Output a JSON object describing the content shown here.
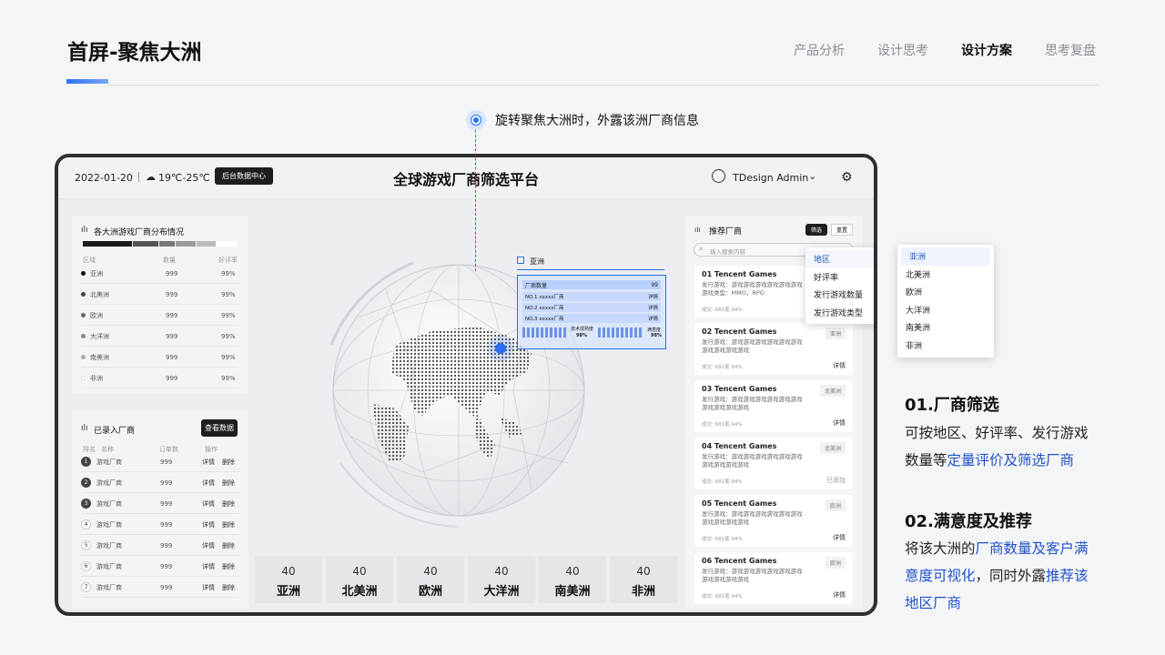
{
  "header": {
    "title": "首屏-聚焦大洲",
    "nav": [
      "产品分析",
      "设计思考",
      "设计方案",
      "思考复盘"
    ],
    "active_index": 2
  },
  "callout": {
    "text": "旋转聚焦大洲时，外露该洲厂商信息"
  },
  "dashboard": {
    "date": "2022-01-20",
    "weather": "19℃-25℃",
    "backend_button": "后台数据中心",
    "title": "全球游戏厂商筛选平台",
    "user": "TDesign Admin",
    "distribution": {
      "title": "各大洲游戏厂商分布情况",
      "headers": [
        "区域",
        "数量",
        "好评率"
      ],
      "rows": [
        {
          "region": "亚洲",
          "count": "999",
          "rate": "99%",
          "color": "#111"
        },
        {
          "region": "北美洲",
          "count": "999",
          "rate": "99%",
          "color": "#444"
        },
        {
          "region": "欧洲",
          "count": "999",
          "rate": "99%",
          "color": "#666"
        },
        {
          "region": "大洋洲",
          "count": "999",
          "rate": "99%",
          "color": "#888"
        },
        {
          "region": "南美洲",
          "count": "999",
          "rate": "99%",
          "color": "#aaa"
        },
        {
          "region": "非洲",
          "count": "999",
          "rate": "99%",
          "color": "#fff"
        }
      ]
    },
    "entered": {
      "title": "已录入厂商",
      "view_button": "查看数据",
      "headers": [
        "排名",
        "名称",
        "订单数",
        "操作"
      ],
      "rows": [
        {
          "rank": "1",
          "name": "游戏厂商",
          "orders": "999",
          "detail": "详情",
          "delete": "删除"
        },
        {
          "rank": "2",
          "name": "游戏厂商",
          "orders": "999",
          "detail": "详情",
          "delete": "删除"
        },
        {
          "rank": "3",
          "name": "游戏厂商",
          "orders": "999",
          "detail": "详情",
          "delete": "删除"
        },
        {
          "rank": "4",
          "name": "游戏厂商",
          "orders": "999",
          "detail": "详情",
          "delete": "删除"
        },
        {
          "rank": "5",
          "name": "游戏厂商",
          "orders": "999",
          "detail": "详情",
          "delete": "删除"
        },
        {
          "rank": "6",
          "name": "游戏厂商",
          "orders": "999",
          "detail": "详情",
          "delete": "删除"
        },
        {
          "rank": "7",
          "name": "游戏厂商",
          "orders": "999",
          "detail": "详情",
          "delete": "删除"
        }
      ]
    },
    "globe_popup": {
      "region": "亚洲",
      "header_label": "厂商数量",
      "header_value": "99",
      "rows": [
        {
          "label": "NO.1  xxxxx厂商",
          "action": "详情"
        },
        {
          "label": "NO.2  xxxxx厂商",
          "action": "详情"
        },
        {
          "label": "NO.3  xxxxx厂商",
          "action": "详情"
        }
      ],
      "stat1_label": "技术成熟度",
      "stat1_value": "98%",
      "stat2_label": "满意度",
      "stat2_value": "98%"
    },
    "continents": [
      {
        "value": "40",
        "name": "亚洲"
      },
      {
        "value": "40",
        "name": "北美洲"
      },
      {
        "value": "40",
        "name": "欧洲"
      },
      {
        "value": "40",
        "name": "大洋洲"
      },
      {
        "value": "40",
        "name": "南美洲"
      },
      {
        "value": "40",
        "name": "非洲"
      }
    ],
    "recommend": {
      "title": "推荐厂商",
      "filter_button": "筛选",
      "reset_button": "重置",
      "search_placeholder": "输入搜索内容",
      "cards": [
        {
          "name": "01 Tencent Games",
          "line1": "发行游戏：游戏游戏游戏游戏游戏游戏",
          "line2": "游戏类型：MMO，RPG",
          "tag": "",
          "meta": "成交: 681笔   94%",
          "action": ""
        },
        {
          "name": "02 Tencent Games",
          "line1": "发行游戏：游戏游戏游戏游戏游戏游戏",
          "line2": "游戏游戏游戏游戏",
          "tag": "亚洲",
          "meta": "成交: 681笔   94%",
          "action": "详情"
        },
        {
          "name": "03 Tencent Games",
          "line1": "发行游戏：游戏游戏游戏游戏游戏游戏",
          "line2": "游戏游戏游戏游戏",
          "tag": "北美洲",
          "meta": "成交: 681笔   94%",
          "action": "详情"
        },
        {
          "name": "04 Tencent Games",
          "line1": "发行游戏：游戏游戏游戏游戏游戏游戏",
          "line2": "游戏游戏游戏游戏",
          "tag": "北美洲",
          "meta": "成交: 681笔   94%",
          "action": "已添加"
        },
        {
          "name": "05 Tencent Games",
          "line1": "发行游戏：游戏游戏游戏游戏游戏游戏",
          "line2": "游戏游戏游戏游戏",
          "tag": "欧洲",
          "meta": "成交: 681笔   94%",
          "action": "详情"
        },
        {
          "name": "06 Tencent Games",
          "line1": "发行游戏：游戏游戏游戏游戏游戏游戏",
          "line2": "游戏游戏游戏游戏",
          "tag": "欧洲",
          "meta": "成交: 681笔   94%",
          "action": "详情"
        }
      ]
    },
    "filter_menu": [
      "地区",
      "好评率",
      "发行游戏数量",
      "发行游戏类型"
    ],
    "region_menu": [
      "亚洲",
      "北美洲",
      "欧洲",
      "大洋洲",
      "南美洲",
      "非洲"
    ]
  },
  "notes": {
    "s1_title": "01.厂商筛选",
    "s1_text_a": "可按地区、好评率、发行游戏",
    "s1_text_b": "数量等",
    "s1_text_blue": "定量评价及筛选厂商",
    "s2_title": "02.满意度及推荐",
    "s2_l1_a": "将该大洲的",
    "s2_l1_blue": "厂商数量及客户满",
    "s2_l2_blue": "意度可视化",
    "s2_l2_b": "，同时外露",
    "s2_l2_blue2": "推荐该",
    "s2_l3_blue": "地区厂商"
  },
  "colors": {
    "accent": "#2b6ff0",
    "highlight_text": "#2152c9"
  }
}
